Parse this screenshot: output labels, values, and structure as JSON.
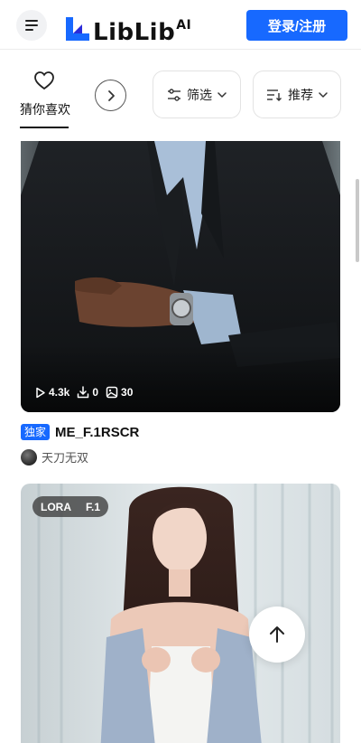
{
  "header": {
    "menu_icon": "hamburger-icon",
    "logo_text": "LibLib",
    "logo_suffix": "AI",
    "login_label": "登录/注册",
    "accent_color": "#1769ff"
  },
  "filterbar": {
    "favorite_tab_label": "猜你喜欢",
    "favorite_icon": "heart-icon",
    "next_icon": "chevron-right-icon",
    "filter_label": "筛选",
    "filter_icon": "sliders-icon",
    "sort_label": "推荐",
    "sort_icon": "sort-icon"
  },
  "cards": [
    {
      "views": "4.3k",
      "downloads": "0",
      "images": "30",
      "badge": "独家",
      "title": "ME_F.1RSCR",
      "author": "天刀无双"
    },
    {
      "tags": [
        "LORA",
        "F.1"
      ]
    }
  ],
  "back_to_top_icon": "arrow-up-icon"
}
